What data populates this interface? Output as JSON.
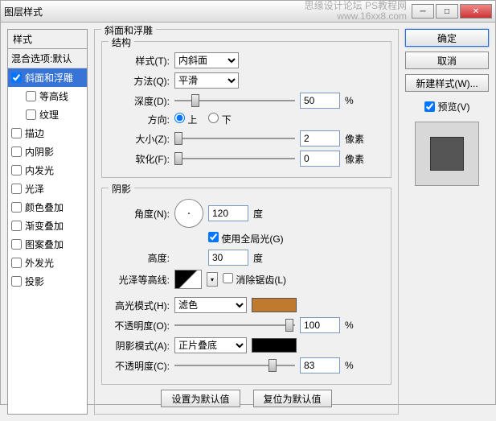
{
  "window": {
    "title": "图层样式"
  },
  "watermark": {
    "line1": "思缘设计论坛  PS教程网",
    "line2": "www.16xx8.com"
  },
  "left": {
    "header": "样式",
    "blend_label": "混合选项:默认",
    "items": [
      {
        "checked": true,
        "label": "斜面和浮雕",
        "selected": true
      },
      {
        "checked": false,
        "label": "等高线",
        "sub": true
      },
      {
        "checked": false,
        "label": "纹理",
        "sub": true
      },
      {
        "checked": false,
        "label": "描边"
      },
      {
        "checked": false,
        "label": "内阴影"
      },
      {
        "checked": false,
        "label": "内发光"
      },
      {
        "checked": false,
        "label": "光泽"
      },
      {
        "checked": false,
        "label": "颜色叠加"
      },
      {
        "checked": false,
        "label": "渐变叠加"
      },
      {
        "checked": false,
        "label": "图案叠加"
      },
      {
        "checked": false,
        "label": "外发光"
      },
      {
        "checked": false,
        "label": "投影"
      }
    ]
  },
  "main": {
    "title": "斜面和浮雕",
    "structure": {
      "group_title": "结构",
      "style_label": "样式(T):",
      "style_value": "内斜面",
      "technique_label": "方法(Q):",
      "technique_value": "平滑",
      "depth_label": "深度(D):",
      "depth_value": "50",
      "depth_unit": "%",
      "direction_label": "方向:",
      "up_label": "上",
      "down_label": "下",
      "size_label": "大小(Z):",
      "size_value": "2",
      "size_unit": "像素",
      "soften_label": "软化(F):",
      "soften_value": "0",
      "soften_unit": "像素"
    },
    "shading": {
      "group_title": "阴影",
      "angle_label": "角度(N):",
      "angle_value": "120",
      "angle_unit": "度",
      "global_label": "使用全局光(G)",
      "altitude_label": "高度:",
      "altitude_value": "30",
      "altitude_unit": "度",
      "gloss_label": "光泽等高线:",
      "anti_label": "消除锯齿(L)",
      "hl_mode_label": "高光模式(H):",
      "hl_mode_value": "滤色",
      "hl_color": "#c07a2e",
      "hl_opacity_label": "不透明度(O):",
      "hl_opacity_value": "100",
      "hl_opacity_unit": "%",
      "sh_mode_label": "阴影模式(A):",
      "sh_mode_value": "正片叠底",
      "sh_color": "#000000",
      "sh_opacity_label": "不透明度(C):",
      "sh_opacity_value": "83",
      "sh_opacity_unit": "%"
    },
    "buttons": {
      "default": "设置为默认值",
      "reset": "复位为默认值"
    }
  },
  "right": {
    "ok": "确定",
    "cancel": "取消",
    "new_style": "新建样式(W)...",
    "preview_label": "预览(V)"
  }
}
